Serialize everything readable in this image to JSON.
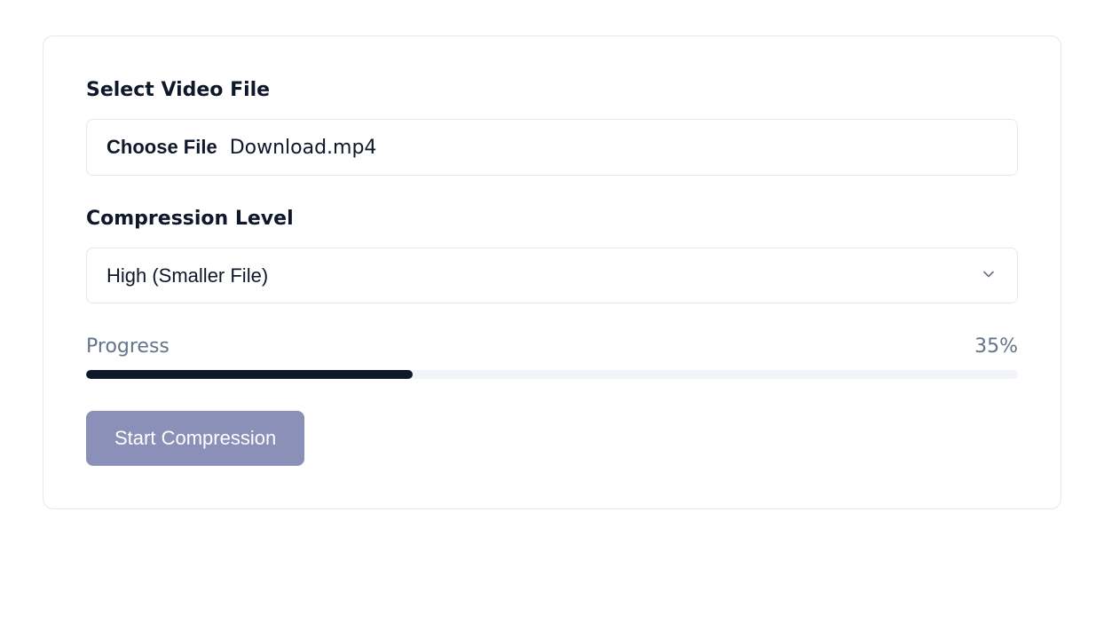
{
  "fileSection": {
    "label": "Select Video File",
    "chooseButtonLabel": "Choose File",
    "selectedFileName": "Download.mp4"
  },
  "compressionSection": {
    "label": "Compression Level",
    "selectedValue": "High (Smaller File)"
  },
  "progress": {
    "label": "Progress",
    "percent": 35,
    "percentText": "35%"
  },
  "startButton": {
    "label": "Start Compression"
  }
}
